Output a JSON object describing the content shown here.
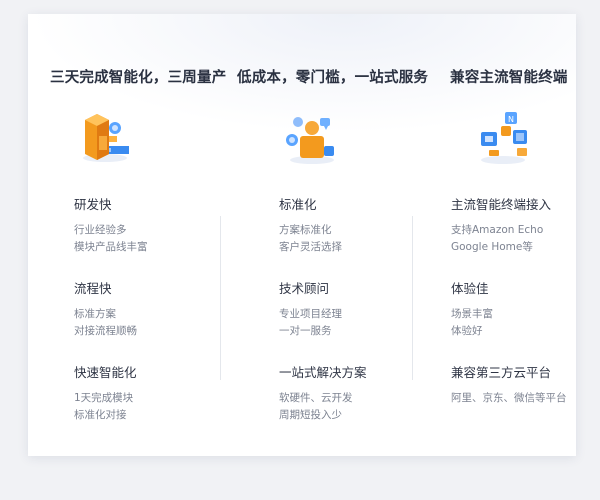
{
  "columns": [
    {
      "title": "三天完成智能化，三周量产",
      "icon": "boxes-assembly-icon",
      "items": [
        {
          "title": "研发快",
          "lines": [
            "行业经验多",
            "模块产品线丰富"
          ]
        },
        {
          "title": "流程快",
          "lines": [
            "标准方案",
            "对接流程顺畅"
          ]
        },
        {
          "title": "快速智能化",
          "lines": [
            "1天完成模块",
            "标准化对接"
          ]
        }
      ]
    },
    {
      "title": "低成本，零门槛，一站式服务",
      "icon": "service-person-icon",
      "items": [
        {
          "title": "标准化",
          "lines": [
            "方案标准化",
            "客户灵活选择"
          ]
        },
        {
          "title": "技术顾问",
          "lines": [
            "专业项目经理",
            "一对一服务"
          ]
        },
        {
          "title": "一站式解决方案",
          "lines": [
            "软硬件、云开发",
            "周期短投入少"
          ]
        }
      ]
    },
    {
      "title": "兼容主流智能终端",
      "icon": "smart-devices-icon",
      "items": [
        {
          "title": "主流智能终端接入",
          "lines": [
            "支持Amazon Echo",
            "Google Home等"
          ]
        },
        {
          "title": "体验佳",
          "lines": [
            "场景丰富",
            "体验好"
          ]
        },
        {
          "title": "兼容第三方云平台",
          "lines": [
            "阿里、京东、微信等平台"
          ]
        }
      ]
    }
  ],
  "colors": {
    "accent_orange": "#f39a1e",
    "accent_blue": "#3a8bf0"
  }
}
